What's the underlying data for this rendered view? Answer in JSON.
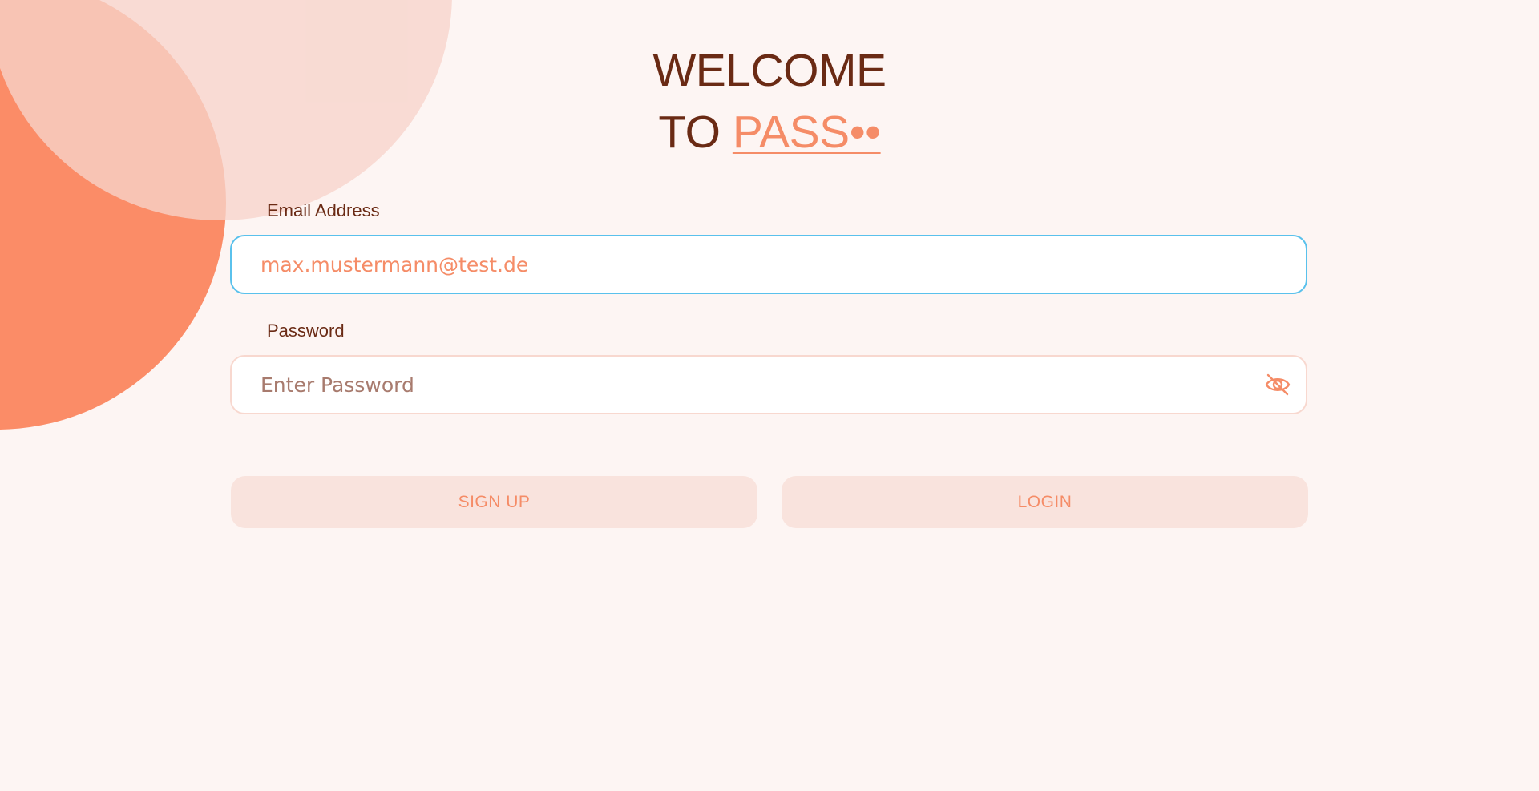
{
  "heading": {
    "line1": "WELCOME",
    "line2_prefix": "TO ",
    "brand": "PASS••"
  },
  "form": {
    "email": {
      "label": "Email Address",
      "value": "max.mustermann@test.de"
    },
    "password": {
      "label": "Password",
      "placeholder": "Enter Password",
      "value": "",
      "toggle_icon": "eye-off-icon"
    }
  },
  "actions": {
    "signup_label": "SIGN UP",
    "login_label": "LOGIN"
  },
  "colors": {
    "background": "#fdf5f3",
    "accent": "#f58c67",
    "text_dark": "#6a2a14",
    "focus_border": "#5ac1ec",
    "button_bg": "#f9e3dd"
  }
}
